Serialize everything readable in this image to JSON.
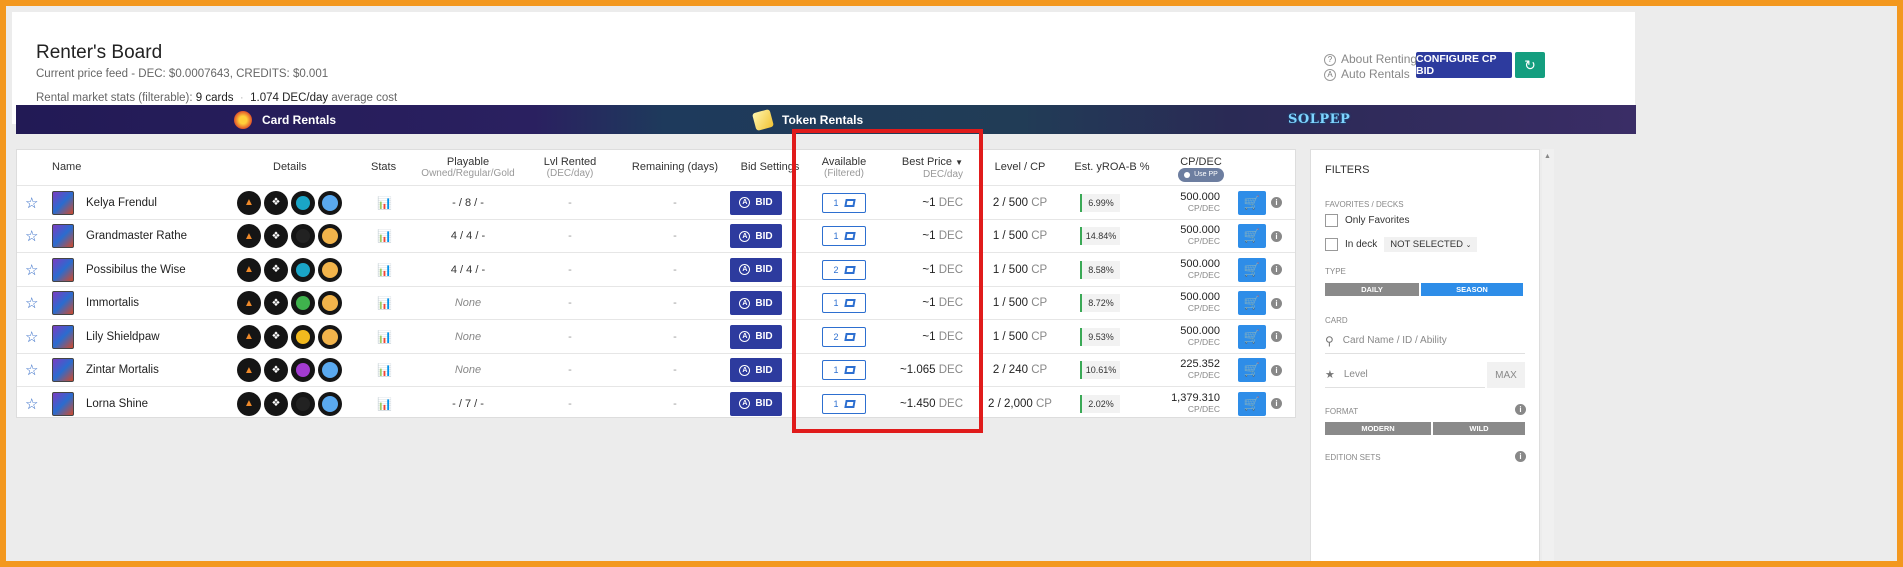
{
  "header": {
    "title": "Renter's Board",
    "price_feed": "Current price feed - DEC: $0.0007643, CREDITS: $0.001",
    "stats_prefix": "Rental market stats (filterable):",
    "stats_cards": "9 cards",
    "stats_dot": "·",
    "stats_cost": "1.074 DEC/day",
    "stats_suffix": "average cost",
    "about_renting": "About Renting",
    "auto_rentals": "Auto Rentals",
    "configure_btn": "CONFIGURE CP BID",
    "about_icon": "question-circle-icon",
    "auto_icon": "a-circle-icon",
    "refresh_icon": "refresh-icon"
  },
  "tabs": {
    "card_rentals": "Card Rentals",
    "token_rentals": "Token Rentals",
    "solpep": "SOLPEP"
  },
  "columns": {
    "name": "Name",
    "details": "Details",
    "stats": "Stats",
    "playable": "Playable",
    "playable_sub": "Owned/Regular/Gold",
    "lvl_rented": "Lvl Rented",
    "lvl_rented_sub": "(DEC/day)",
    "remaining": "Remaining (days)",
    "bid_settings": "Bid Settings",
    "available": "Available",
    "available_sub": "(Filtered)",
    "best_price": "Best Price",
    "best_price_sub": "DEC/day",
    "level_cp": "Level / CP",
    "yroa": "Est. yROA-B %",
    "cpdec": "CP/DEC",
    "use_pp": "Use PP"
  },
  "labels": {
    "bid": "BID",
    "dec": "DEC",
    "cp": "CP",
    "cpdec_unit": "CP/DEC"
  },
  "rows": [
    {
      "name": "Kelya Frendul",
      "playable": "- / 8 / -",
      "lvl_rented": "-",
      "remaining": "-",
      "available": "1",
      "price": "~1",
      "level": "2 / 500",
      "roa": "6.99%",
      "cpdec": "500.000",
      "last_color": "#5aa9ef",
      "third": "#1aa5c7"
    },
    {
      "name": "Grandmaster Rathe",
      "playable": "4 / 4 / -",
      "lvl_rented": "-",
      "remaining": "-",
      "available": "1",
      "price": "~1",
      "level": "1 / 500",
      "roa": "14.84%",
      "cpdec": "500.000",
      "last_color": "#f2b44b",
      "third": "#222"
    },
    {
      "name": "Possibilus the Wise",
      "playable": "4 / 4 / -",
      "lvl_rented": "-",
      "remaining": "-",
      "available": "2",
      "price": "~1",
      "level": "1 / 500",
      "roa": "8.58%",
      "cpdec": "500.000",
      "last_color": "#f2b44b",
      "third": "#1aa5c7"
    },
    {
      "name": "Immortalis",
      "playable": "None",
      "lvl_rented": "-",
      "remaining": "-",
      "available": "1",
      "price": "~1",
      "level": "1 / 500",
      "roa": "8.72%",
      "cpdec": "500.000",
      "last_color": "#f2b44b",
      "third": "#3fb24d"
    },
    {
      "name": "Lily Shieldpaw",
      "playable": "None",
      "lvl_rented": "-",
      "remaining": "-",
      "available": "2",
      "price": "~1",
      "level": "1 / 500",
      "roa": "9.53%",
      "cpdec": "500.000",
      "last_color": "#f2b44b",
      "third": "#f2b91e"
    },
    {
      "name": "Zintar Mortalis",
      "playable": "None",
      "lvl_rented": "-",
      "remaining": "-",
      "available": "1",
      "price": "~1.065",
      "level": "2 / 240",
      "roa": "10.61%",
      "cpdec": "225.352",
      "last_color": "#5aa9ef",
      "third": "#a23bd0"
    },
    {
      "name": "Lorna Shine",
      "playable": "- / 7 / -",
      "lvl_rented": "-",
      "remaining": "-",
      "available": "1",
      "price": "~1.450",
      "level": "2 / 2,000",
      "roa": "2.02%",
      "cpdec": "1,379.310",
      "last_color": "#5aa9ef",
      "third": "#222"
    }
  ],
  "filters": {
    "title": "FILTERS",
    "favorites_label": "FAVORITES / DECKS",
    "only_favorites": "Only Favorites",
    "in_deck": "In deck",
    "not_selected": "NOT SELECTED",
    "type_label": "TYPE",
    "daily": "DAILY",
    "season": "SEASON",
    "card_label": "CARD",
    "card_placeholder": "Card Name / ID / Ability",
    "level_placeholder": "Level",
    "max": "MAX",
    "format_label": "FORMAT",
    "modern": "MODERN",
    "wild": "WILD",
    "edition_label": "EDITION SETS"
  },
  "colors": {
    "primary": "#2d3b9e",
    "accent_blue": "#2e8de8",
    "refresh_green": "#149e7f",
    "highlight_red": "#e01b1b",
    "border_orange": "#f3981f"
  }
}
